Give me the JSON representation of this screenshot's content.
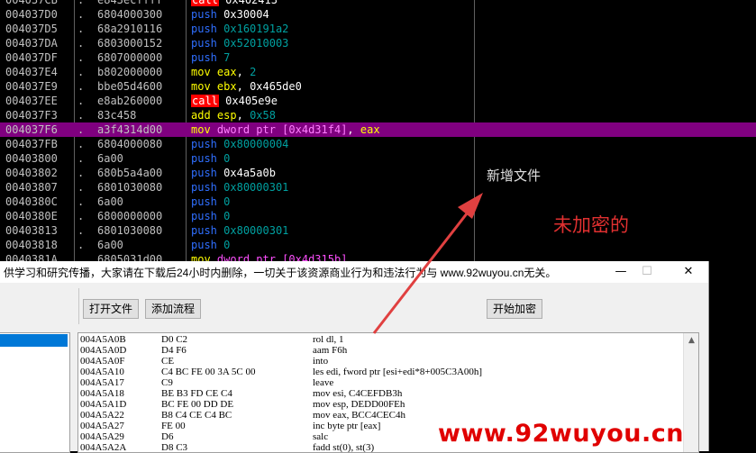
{
  "debugger": {
    "rows": [
      {
        "addr": "004037CB",
        "dot": ".",
        "hex": "e843ecffff",
        "mn": "call",
        "ops": [
          {
            "t": "0x402413",
            "c": "o-wht"
          }
        ]
      },
      {
        "addr": "004037D0",
        "dot": ".",
        "hex": "6804000300",
        "mn": "push",
        "ops": [
          {
            "t": "0x30004",
            "c": "o-wht"
          }
        ]
      },
      {
        "addr": "004037D5",
        "dot": ".",
        "hex": "68a2910116",
        "mn": "push",
        "ops": [
          {
            "t": "0x160191a2",
            "c": "o-imm"
          }
        ]
      },
      {
        "addr": "004037DA",
        "dot": ".",
        "hex": "6803000152",
        "mn": "push",
        "ops": [
          {
            "t": "0x52010003",
            "c": "o-imm"
          }
        ]
      },
      {
        "addr": "004037DF",
        "dot": ".",
        "hex": "6807000000",
        "mn": "push",
        "ops": [
          {
            "t": "7",
            "c": "o-imm"
          }
        ]
      },
      {
        "addr": "004037E4",
        "dot": ".",
        "hex": "b802000000",
        "mn": "mov",
        "ops": [
          {
            "t": "eax",
            "c": "o-reg"
          },
          {
            "t": ", ",
            "c": "o-wht"
          },
          {
            "t": "2",
            "c": "o-imm"
          }
        ]
      },
      {
        "addr": "004037E9",
        "dot": ".",
        "hex": "bbe05d4600",
        "mn": "mov",
        "ops": [
          {
            "t": "ebx",
            "c": "o-reg"
          },
          {
            "t": ", ",
            "c": "o-wht"
          },
          {
            "t": "0x465de0",
            "c": "o-wht"
          }
        ]
      },
      {
        "addr": "004037EE",
        "dot": ".",
        "hex": "e8ab260000",
        "mn": "call",
        "ops": [
          {
            "t": "0x405e9e",
            "c": "o-wht"
          }
        ]
      },
      {
        "addr": "004037F3",
        "dot": ".",
        "hex": "83c458",
        "mn": "add",
        "ops": [
          {
            "t": "esp",
            "c": "o-reg"
          },
          {
            "t": ", ",
            "c": "o-wht"
          },
          {
            "t": "0x58",
            "c": "o-imm"
          }
        ]
      },
      {
        "addr": "004037F6",
        "dot": ".",
        "hex": "a3f4314d00",
        "mn": "mov",
        "hl": true,
        "ops": [
          {
            "t": "dword ptr [0x4d31f4]",
            "c": "o-mem"
          },
          {
            "t": ", ",
            "c": "o-wht"
          },
          {
            "t": "eax",
            "c": "o-reg"
          }
        ]
      },
      {
        "addr": "004037FB",
        "dot": ".",
        "hex": "6804000080",
        "mn": "push",
        "ops": [
          {
            "t": "0x80000004",
            "c": "o-imm"
          }
        ]
      },
      {
        "addr": "00403800",
        "dot": ".",
        "hex": "6a00",
        "mn": "push",
        "ops": [
          {
            "t": "0",
            "c": "o-imm"
          }
        ]
      },
      {
        "addr": "00403802",
        "dot": ".",
        "hex": "680b5a4a00",
        "mn": "push",
        "ops": [
          {
            "t": "0x4a5a0b",
            "c": "o-wht"
          }
        ]
      },
      {
        "addr": "00403807",
        "dot": ".",
        "hex": "6801030080",
        "mn": "push",
        "ops": [
          {
            "t": "0x80000301",
            "c": "o-imm"
          }
        ]
      },
      {
        "addr": "0040380C",
        "dot": ".",
        "hex": "6a00",
        "mn": "push",
        "ops": [
          {
            "t": "0",
            "c": "o-imm"
          }
        ]
      },
      {
        "addr": "0040380E",
        "dot": ".",
        "hex": "6800000000",
        "mn": "push",
        "ops": [
          {
            "t": "0",
            "c": "o-imm"
          }
        ]
      },
      {
        "addr": "00403813",
        "dot": ".",
        "hex": "6801030080",
        "mn": "push",
        "ops": [
          {
            "t": "0x80000301",
            "c": "o-imm"
          }
        ]
      },
      {
        "addr": "00403818",
        "dot": ".",
        "hex": "6a00",
        "mn": "push",
        "ops": [
          {
            "t": "0",
            "c": "o-imm"
          }
        ]
      },
      {
        "addr": "0040381A",
        "dot": ".",
        "hex": "6805031d00",
        "mn": "mov",
        "ops": [
          {
            "t": "dword ptr [0x4d315b]",
            "c": "o-mem"
          }
        ]
      }
    ]
  },
  "annotations": {
    "new_file": "新增文件",
    "unencrypted": "未加密的"
  },
  "window": {
    "title": "供学习和研究传播，大家请在下载后24小时内删除，一切关于该资源商业行为和违法行为与 www.92wuyou.cn无关。",
    "min_icon": "—",
    "max_icon": "☐",
    "close_icon": "✕",
    "buttons": {
      "open_file": "打开文件",
      "add_flow": "添加流程",
      "start_encrypt": "开始加密"
    },
    "list_rows": [
      {
        "addr": "004A5A0B",
        "hex": "D0 C2",
        "ins": "rol dl, 1"
      },
      {
        "addr": "004A5A0D",
        "hex": "D4 F6",
        "ins": "aam F6h"
      },
      {
        "addr": "004A5A0F",
        "hex": "CE",
        "ins": "into"
      },
      {
        "addr": "004A5A10",
        "hex": "C4 BC FE 00 3A 5C 00",
        "ins": "les edi, fword ptr [esi+edi*8+005C3A00h]"
      },
      {
        "addr": "004A5A17",
        "hex": "C9",
        "ins": "leave"
      },
      {
        "addr": "004A5A18",
        "hex": "BE B3 FD CE C4",
        "ins": "mov esi, C4CEFDB3h"
      },
      {
        "addr": "004A5A1D",
        "hex": "BC FE 00 DD DE",
        "ins": "mov esp, DEDD00FEh"
      },
      {
        "addr": "004A5A22",
        "hex": "B8 C4 CE C4 BC",
        "ins": "mov eax, BCC4CEC4h"
      },
      {
        "addr": "004A5A27",
        "hex": "FE 00",
        "ins": "inc byte ptr [eax]"
      },
      {
        "addr": "004A5A29",
        "hex": "D6",
        "ins": "salc"
      },
      {
        "addr": "004A5A2A",
        "hex": "D8 C3",
        "ins": "fadd st(0), st(3)"
      }
    ],
    "scroll_up_icon": "▲"
  },
  "watermark": "www.92wuyou.cn",
  "colors": {
    "highlight_row": "#800080",
    "call_bg": "#ff0000",
    "push": "#2f6fff",
    "annotation_red": "#e03030",
    "arrow": "#e04040"
  }
}
